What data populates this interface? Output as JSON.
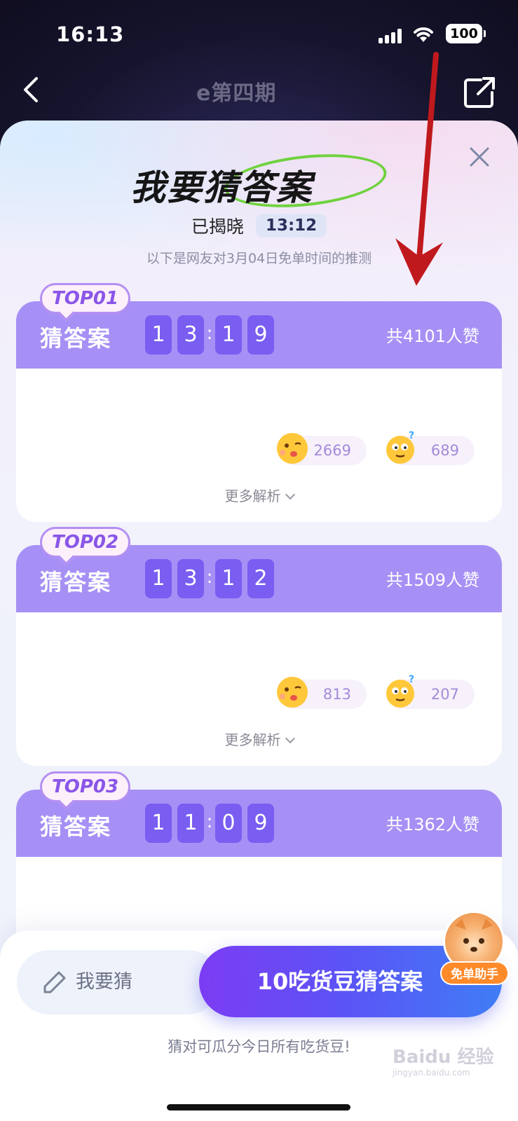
{
  "status_bar": {
    "time": "16:13",
    "battery": "100"
  },
  "header": {
    "period": "e第四期"
  },
  "modal": {
    "title": "我要猜答案",
    "revealed_label": "已揭晓",
    "revealed_time": "13:12",
    "subtitle": "以下是网友对3月04日免单时间的推测"
  },
  "cards": [
    {
      "rank": "TOP01",
      "label": "猜答案",
      "digits": [
        "1",
        "3",
        "1",
        "9"
      ],
      "likes_total": "共4101人赞",
      "reactions": [
        {
          "icon": "kiss-emoji-icon",
          "count": "2669"
        },
        {
          "icon": "thinking-emoji-icon",
          "count": "689"
        }
      ],
      "more": "更多解析"
    },
    {
      "rank": "TOP02",
      "label": "猜答案",
      "digits": [
        "1",
        "3",
        "1",
        "2"
      ],
      "likes_total": "共1509人赞",
      "reactions": [
        {
          "icon": "kiss-emoji-icon",
          "count": "813"
        },
        {
          "icon": "thinking-emoji-icon",
          "count": "207"
        }
      ],
      "more": "更多解析"
    },
    {
      "rank": "TOP03",
      "label": "猜答案",
      "digits": [
        "1",
        "1",
        "0",
        "9"
      ],
      "likes_total": "共1362人赞",
      "reactions": [],
      "more": ""
    }
  ],
  "bottom": {
    "my_guess": "我要猜",
    "cta": "10吃货豆猜答案",
    "helper": "免单助手",
    "note": "猜对可瓜分今日所有吃货豆!"
  },
  "watermark": {
    "main": "Baidu 经验",
    "sub": "jingyan.baidu.com"
  },
  "colors": {
    "accent": "#a690f5",
    "digit_bg": "#7a5df1",
    "cta_start": "#7c3cf3",
    "cta_end": "#3f7df5",
    "arrow": "#c0191d"
  }
}
